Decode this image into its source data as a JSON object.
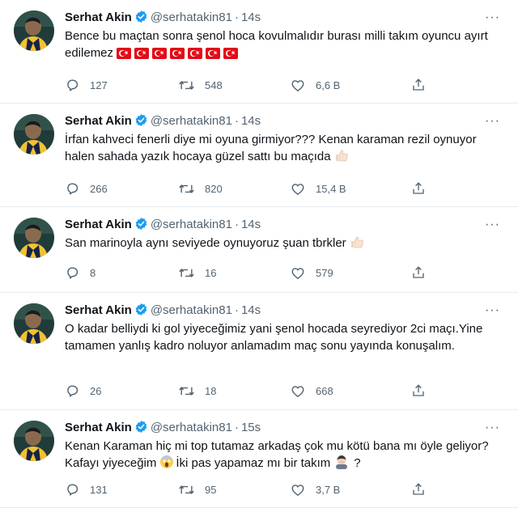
{
  "colors": {
    "text": "#0f1419",
    "muted": "#536471",
    "verified": "#1d9bf0",
    "divider": "#e6ecf0"
  },
  "icons": {
    "verified": "verified-badge-icon",
    "more": "more-options-icon",
    "reply": "reply-icon",
    "retweet": "retweet-icon",
    "like": "like-icon",
    "share": "share-icon"
  },
  "tweets": [
    {
      "name": "Serhat Akin",
      "handle": "@serhatakin81",
      "sep": "·",
      "time": "14s",
      "more": "···",
      "text": "Bence bu maçtan sonra şenol hoca kovulmalıdır burası milli takım oyuncu ayırt edilemez",
      "emojis": [
        "turkish-flag",
        "turkish-flag",
        "turkish-flag",
        "turkish-flag",
        "turkish-flag",
        "turkish-flag",
        "turkish-flag"
      ],
      "replies": "127",
      "retweets": "548",
      "likes": "6,6 B"
    },
    {
      "name": "Serhat Akin",
      "handle": "@serhatakin81",
      "sep": "·",
      "time": "14s",
      "more": "···",
      "text": "İrfan kahveci fenerli diye mi oyuna girmiyor??? Kenan karaman rezil oynuyor halen sahada yazık hocaya güzel sattı bu maçıda",
      "emojis": [
        "thumbs-up"
      ],
      "replies": "266",
      "retweets": "820",
      "likes": "15,4 B"
    },
    {
      "name": "Serhat Akin",
      "handle": "@serhatakin81",
      "sep": "·",
      "time": "14s",
      "more": "···",
      "text": "San marinoyla aynı seviyede oynuyoruz şuan tbrkler",
      "emojis": [
        "thumbs-up"
      ],
      "replies": "8",
      "retweets": "16",
      "likes": "579"
    },
    {
      "name": "Serhat Akin",
      "handle": "@serhatakin81",
      "sep": "·",
      "time": "14s",
      "more": "···",
      "text": "O kadar belliydi ki gol yiyeceğimiz yani şenol hocada seyrediyor 2ci maçı.Yine tamamen yanlış kadro noluyor anlamadım maç sonu yayında konuşalım.",
      "emojis": [],
      "replies": "26",
      "retweets": "18",
      "likes": "668"
    },
    {
      "name": "Serhat Akin",
      "handle": "@serhatakin81",
      "sep": "·",
      "time": "15s",
      "more": "···",
      "text_a": "Kenan Karaman hiç mi top tutamaz arkadaş çok mu kötü bana mı öyle geliyor? Kafayı yiyeceğim",
      "text_b": "İki pas yapamaz mı bir takım",
      "text_c": "?",
      "emojis": [
        "screaming-face",
        "person-facepalming"
      ],
      "replies": "131",
      "retweets": "95",
      "likes": "3,7 B"
    }
  ]
}
